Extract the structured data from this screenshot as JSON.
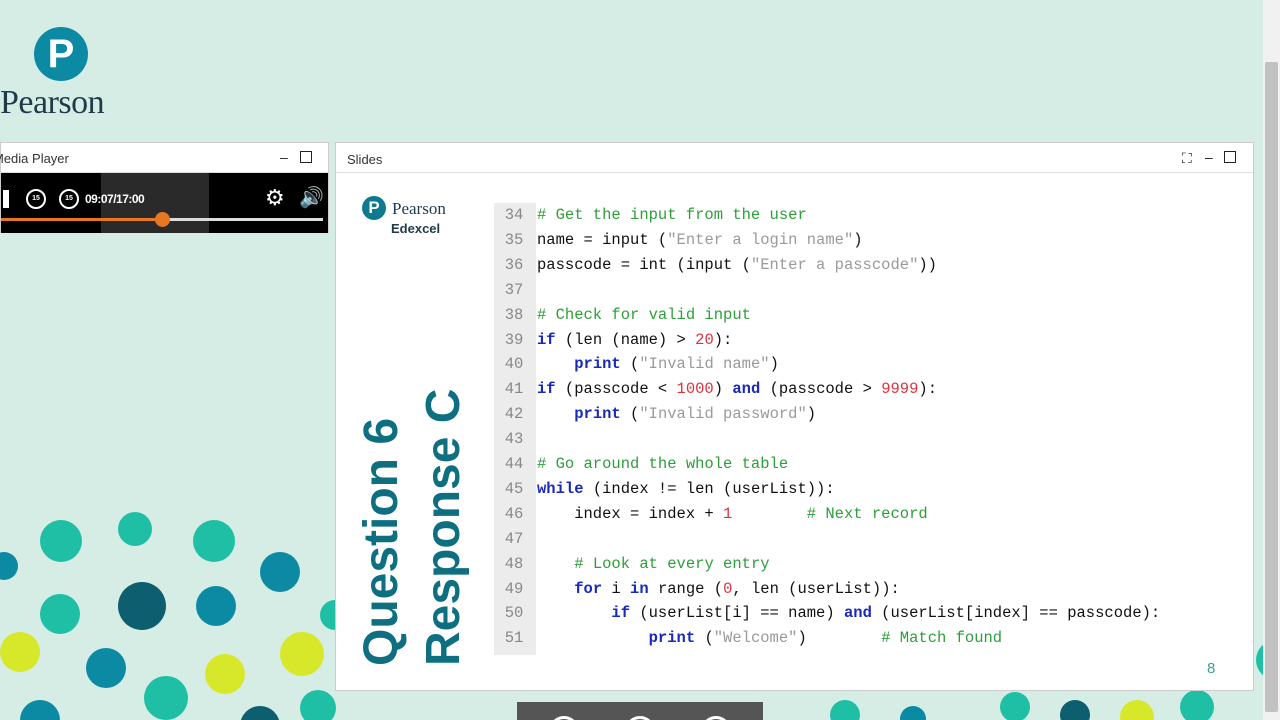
{
  "logo": {
    "letter": "P",
    "name": "Pearson"
  },
  "media_player": {
    "title": "Media Player",
    "minimize": "–",
    "rewind_label": "15",
    "forward_label": "15",
    "time": "09:07/17:00",
    "progress": 0.5
  },
  "slides_panel": {
    "title": "Slides",
    "minimize": "–",
    "slide": {
      "logo_letter": "P",
      "logo_name": "Pearson",
      "logo_sub": "Edexcel",
      "title_line1": "Question 6",
      "title_line2": "Response C",
      "page_number": "8",
      "code_lines": [
        {
          "n": "34",
          "html": "<span class='cm'># Get the input from the user</span>"
        },
        {
          "n": "35",
          "html": "name = input (<span class='str'>\"Enter a login name\"</span>)"
        },
        {
          "n": "36",
          "html": "passcode = int (input (<span class='str'>\"Enter a passcode\"</span>))"
        },
        {
          "n": "37",
          "html": ""
        },
        {
          "n": "38",
          "html": "<span class='cm'># Check for valid input</span>"
        },
        {
          "n": "39",
          "html": "<span class='kw'>if</span> (len (name) > <span class='num'>20</span>):"
        },
        {
          "n": "40",
          "html": "    <span class='kw'>print</span> (<span class='str'>\"Invalid name\"</span>)"
        },
        {
          "n": "41",
          "html": "<span class='kw'>if</span> (passcode < <span class='num'>1000</span>) <span class='kw'>and</span> (passcode > <span class='num'>9999</span>):"
        },
        {
          "n": "42",
          "html": "    <span class='kw'>print</span> (<span class='str'>\"Invalid password\"</span>)"
        },
        {
          "n": "43",
          "html": ""
        },
        {
          "n": "44",
          "html": "<span class='cm'># Go around the whole table</span>"
        },
        {
          "n": "45",
          "html": "<span class='kw'>while</span> (index != len (userList)):"
        },
        {
          "n": "46",
          "html": "    index = index + <span class='num'>1</span>        <span class='cm'># Next record</span>"
        },
        {
          "n": "47",
          "html": ""
        },
        {
          "n": "48",
          "html": "    <span class='cm'># Look at every entry</span>"
        },
        {
          "n": "49",
          "html": "    <span class='kw'>for</span> i <span class='kw'>in</span> range (<span class='num'>0</span>, len (userList)):"
        },
        {
          "n": "50",
          "html": "        <span class='kw'>if</span> (userList[i] == name) <span class='kw'>and</span> (userList[index] == passcode):"
        },
        {
          "n": "51",
          "html": "            <span class='kw'>print</span> (<span class='str'>\"Welcome\"</span>)        <span class='cm'># Match found</span>"
        }
      ]
    }
  },
  "colors": {
    "background": "#d6ede6",
    "accent_teal": "#0d8aa3",
    "progress_orange": "#e87722"
  }
}
